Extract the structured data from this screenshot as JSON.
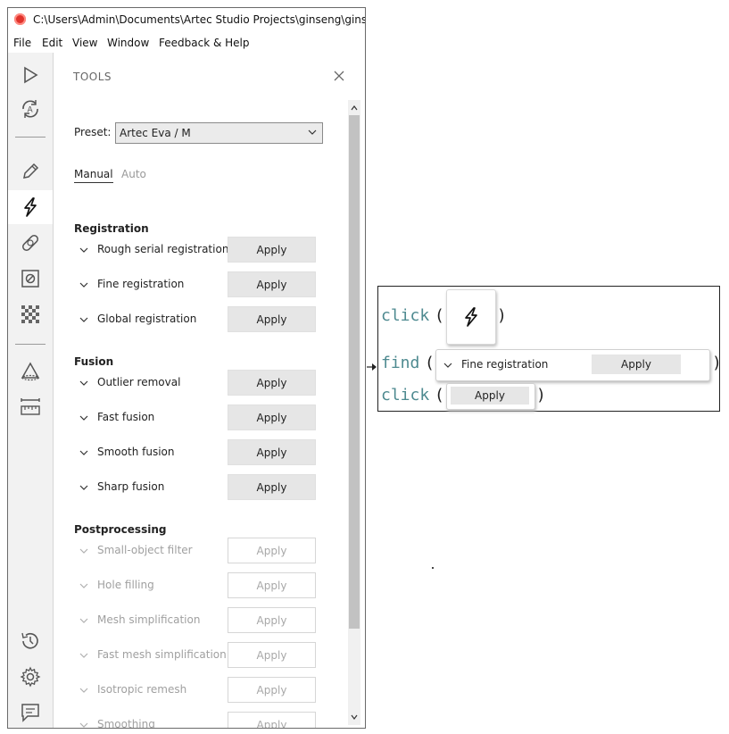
{
  "window": {
    "title": "C:\\Users\\Admin\\Documents\\Artec Studio Projects\\ginseng\\ginseng.sp",
    "menu": [
      "File",
      "Edit",
      "View",
      "Window",
      "Feedback & Help"
    ]
  },
  "sidebar": {
    "icons": [
      "play-icon",
      "autopilot-icon",
      "pencil-icon",
      "lightning-icon",
      "bandage-icon",
      "eraser-box-icon",
      "texture-checker-icon",
      "measure-cone-icon",
      "ruler-icon",
      "history-icon",
      "gear-icon",
      "chat-icon"
    ],
    "active": "lightning-icon"
  },
  "panel": {
    "title": "TOOLS",
    "preset_label": "Preset:",
    "preset_value": "Artec Eva / M",
    "tabs": {
      "manual": "Manual",
      "auto": "Auto"
    },
    "sections": {
      "registration": "Registration",
      "fusion": "Fusion",
      "postprocessing": "Postprocessing"
    },
    "rows": [
      {
        "label": "Rough serial registration",
        "apply": "Apply",
        "enabled": true
      },
      {
        "label": "Fine registration",
        "apply": "Apply",
        "enabled": true
      },
      {
        "label": "Global registration",
        "apply": "Apply",
        "enabled": true
      },
      {
        "label": "Outlier removal",
        "apply": "Apply",
        "enabled": true
      },
      {
        "label": "Fast fusion",
        "apply": "Apply",
        "enabled": true
      },
      {
        "label": "Smooth fusion",
        "apply": "Apply",
        "enabled": true
      },
      {
        "label": "Sharp fusion",
        "apply": "Apply",
        "enabled": true
      },
      {
        "label": "Small-object filter",
        "apply": "Apply",
        "enabled": false
      },
      {
        "label": "Hole filling",
        "apply": "Apply",
        "enabled": false
      },
      {
        "label": "Mesh simplification",
        "apply": "Apply",
        "enabled": false
      },
      {
        "label": "Fast mesh simplification",
        "apply": "Apply",
        "enabled": false
      },
      {
        "label": "Isotropic remesh",
        "apply": "Apply",
        "enabled": false
      },
      {
        "label": "Smoothing",
        "apply": "Apply",
        "enabled": false
      }
    ]
  },
  "annotation": {
    "line1_fn": "click",
    "line2_fn": "find",
    "line3_fn": "click",
    "open_paren": "(",
    "close_paren": ")",
    "find_row_label": "Fine registration",
    "find_row_apply": "Apply",
    "click_apply": "Apply"
  },
  "colors": {
    "accent_code": "#4e8a90",
    "app_icon": "#e0332c",
    "button_bg": "#e6e6e6"
  }
}
